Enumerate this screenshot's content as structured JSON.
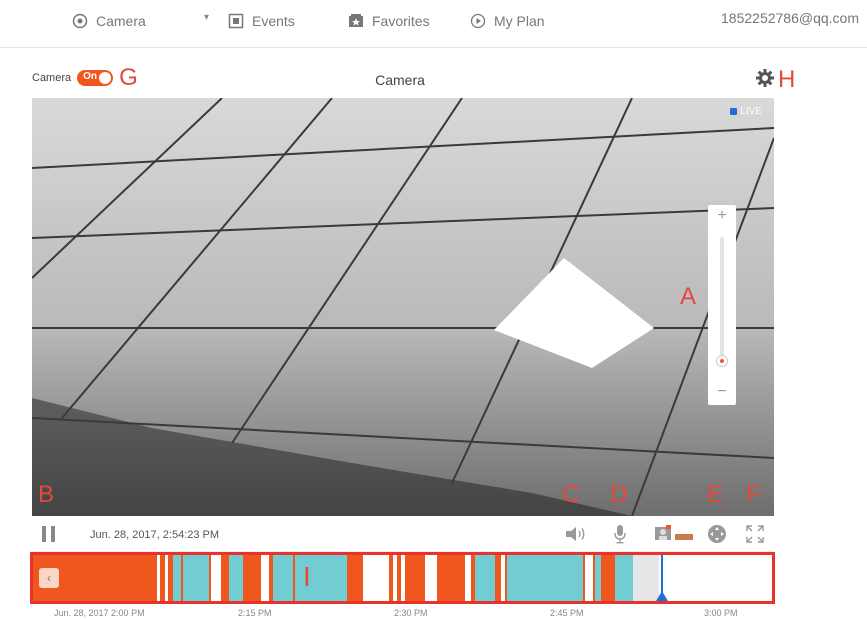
{
  "nav": {
    "items": [
      {
        "label": "Camera",
        "icon": "camera-icon"
      },
      {
        "label": "Events",
        "icon": "events-icon"
      },
      {
        "label": "Favorites",
        "icon": "favorites-icon"
      },
      {
        "label": "My Plan",
        "icon": "play-icon"
      }
    ],
    "caret": "▾",
    "account": "1852252786@qq.com"
  },
  "header": {
    "camera_label": "Camera",
    "toggle_state": "On",
    "title": "Camera"
  },
  "video": {
    "live": "LIVE",
    "zoom_plus": "+",
    "zoom_minus": "−",
    "zoom_level": 0.05
  },
  "controls": {
    "timestamp": "Jun. 28, 2017, 2:54:23 PM"
  },
  "timeline": {
    "back": "‹",
    "labels": [
      "Jun. 28, 2017 2:00 PM",
      "2:15 PM",
      "2:30 PM",
      "2:45 PM",
      "3:00 PM"
    ]
  },
  "markers": {
    "a": "A",
    "b": "B",
    "c": "C",
    "d": "D",
    "e": "E",
    "f": "F",
    "g": "G",
    "h": "H",
    "i": "I"
  },
  "colors": {
    "accent": "#f0571f",
    "highlight": "#e8332c",
    "event": "#72cdd2",
    "live": "#1e6fd9"
  }
}
